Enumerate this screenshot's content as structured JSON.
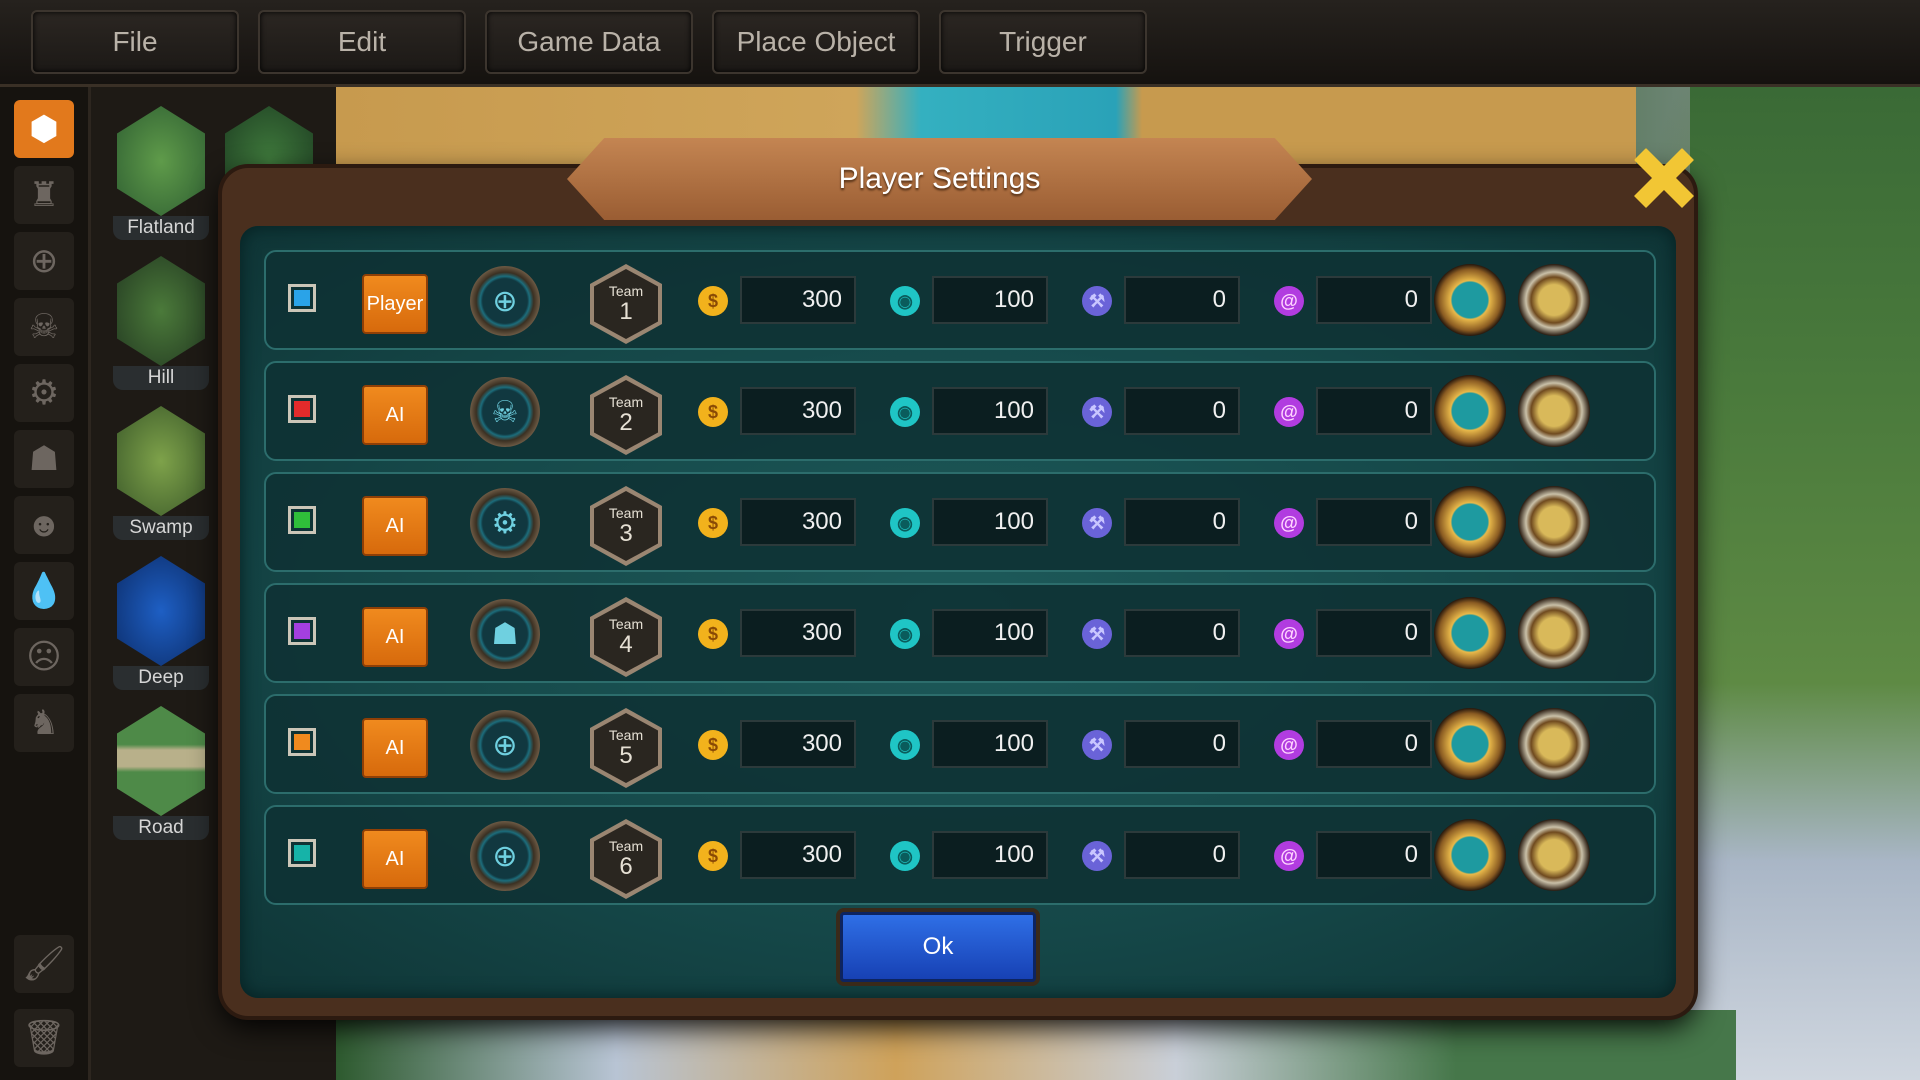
{
  "menu": [
    "File",
    "Edit",
    "Game Data",
    "Place Object",
    "Trigger"
  ],
  "terrain": [
    "Flatland",
    "Hill",
    "Swamp",
    "Deep",
    "Road"
  ],
  "dialog": {
    "title": "Player Settings",
    "ok_label": "Ok",
    "team_label": "Team",
    "players": [
      {
        "color": "#2aa3e8",
        "controller": "Player",
        "team": "1",
        "gold": "300",
        "wood": "100",
        "iron": "0",
        "mana": "0",
        "avatar": "target-icon"
      },
      {
        "color": "#e32b2b",
        "controller": "AI",
        "team": "2",
        "gold": "300",
        "wood": "100",
        "iron": "0",
        "mana": "0",
        "avatar": "skull-icon"
      },
      {
        "color": "#2fbf3a",
        "controller": "AI",
        "team": "3",
        "gold": "300",
        "wood": "100",
        "iron": "0",
        "mana": "0",
        "avatar": "gears-icon"
      },
      {
        "color": "#a33fe0",
        "controller": "AI",
        "team": "4",
        "gold": "300",
        "wood": "100",
        "iron": "0",
        "mana": "0",
        "avatar": "beast-icon"
      },
      {
        "color": "#f08a1e",
        "controller": "AI",
        "team": "5",
        "gold": "300",
        "wood": "100",
        "iron": "0",
        "mana": "0",
        "avatar": "target-icon"
      },
      {
        "color": "#16b3a8",
        "controller": "AI",
        "team": "6",
        "gold": "300",
        "wood": "100",
        "iron": "0",
        "mana": "0",
        "avatar": "target-icon"
      }
    ]
  }
}
